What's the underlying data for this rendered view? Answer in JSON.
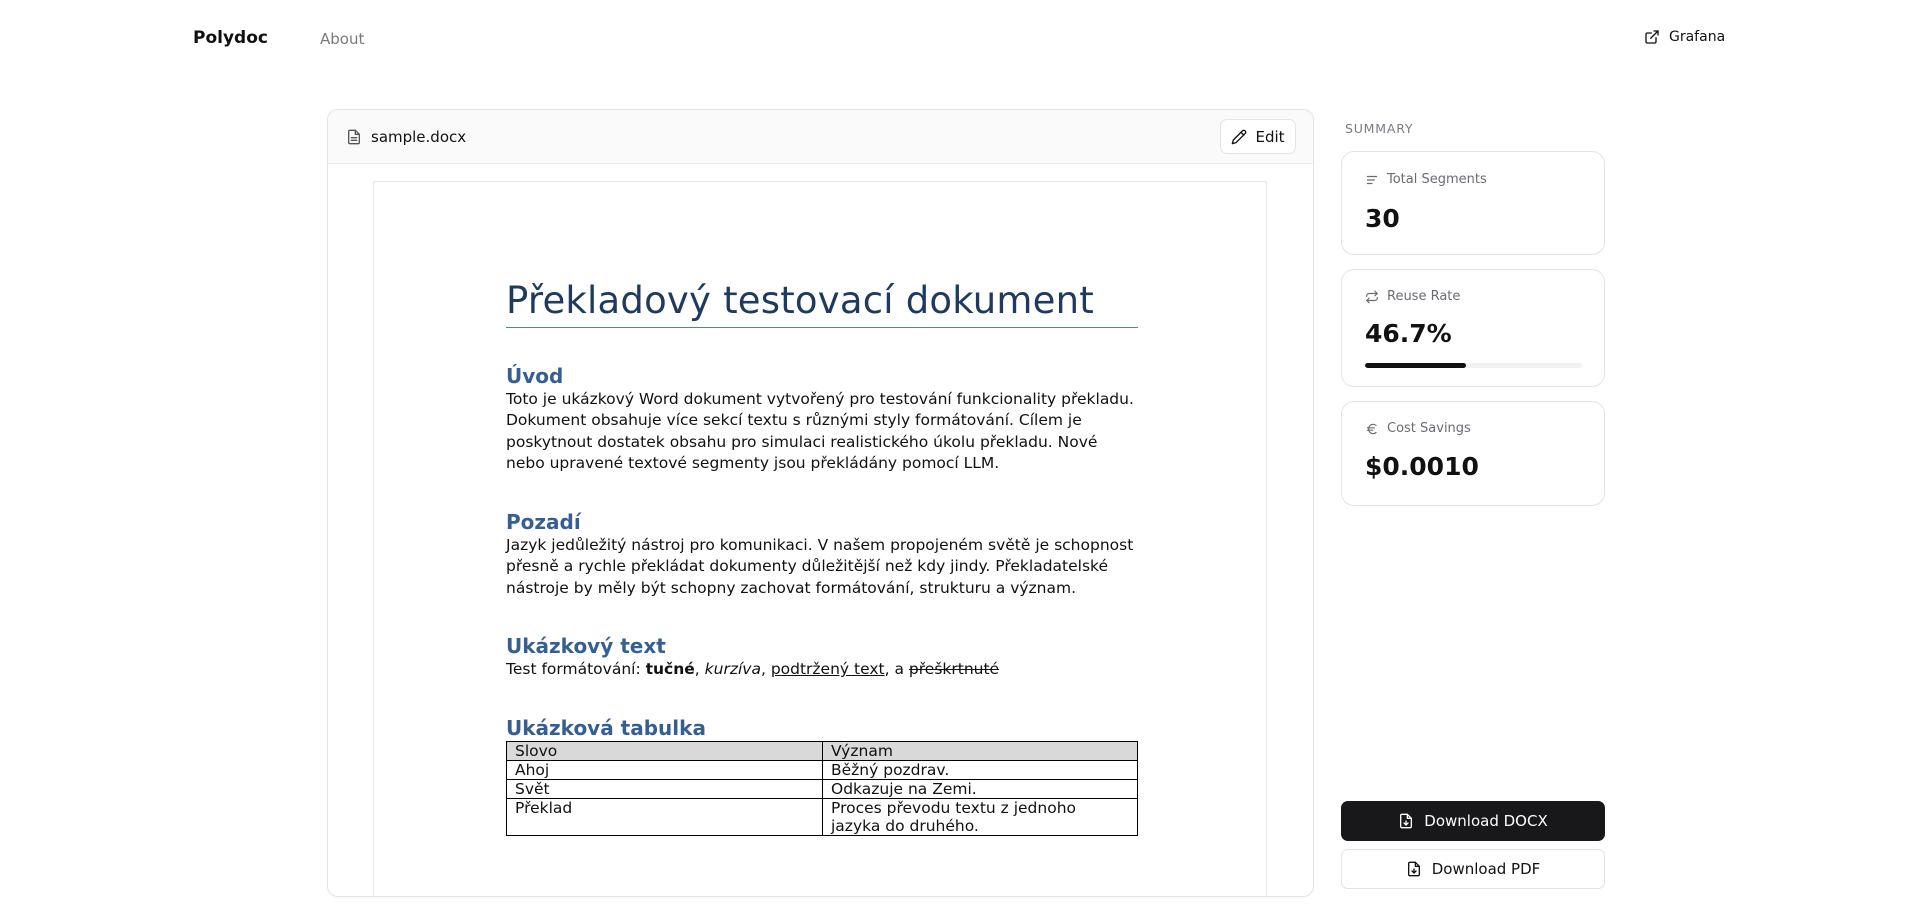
{
  "nav": {
    "brand": "Polydoc",
    "about": "About",
    "external_link": "Grafana",
    "external_icon": "external-link-icon"
  },
  "document": {
    "filename": "sample.docx",
    "file_icon": "file-text-icon",
    "edit_label": "Edit",
    "edit_icon": "pencil-icon",
    "title": "Překladový testovací dokument",
    "sections": {
      "intro_heading": "Úvod",
      "intro_text": "Toto je ukázkový Word dokument vytvořený pro testování funkcionality překladu. Dokument obsahuje více sekcí textu s různými styly formátování. Cílem je poskytnout dostatek obsahu pro simulaci realistického úkolu překladu. Nové nebo upravené textové segmenty jsou překládány pomocí LLM.",
      "background_heading": "Pozadí",
      "background_text": "Jazyk jedůležitý nástroj pro komunikaci. V našem propojeném světě je schopnost přesně a rychle překládat dokumenty důležitější než kdy jindy. Překladatelské nástroje by měly být schopny zachovat formátování, strukturu a význam.",
      "sample_heading": "Ukázkový text",
      "sample_prefix": "Test formátování: ",
      "sample_bold": "tučné",
      "sample_sep1": ", ",
      "sample_italic": "kurzíva",
      "sample_sep2": ", ",
      "sample_underline": "podtržený text",
      "sample_sep3": ", a ",
      "sample_strike": "přeškrtnuté",
      "table_heading": "Ukázková tabulka"
    },
    "table": {
      "headers": [
        "Slovo",
        "Význam"
      ],
      "rows": [
        [
          "Ahoj",
          "Běžný pozdrav."
        ],
        [
          "Svět",
          "Odkazuje na Zemi."
        ],
        [
          "Překlad",
          "Proces převodu textu z jednoho jazyka do druhého."
        ]
      ]
    }
  },
  "summary": {
    "label": "SUMMARY",
    "total_segments": {
      "title": "Total Segments",
      "value": "30",
      "icon": "list-icon"
    },
    "reuse_rate": {
      "title": "Reuse Rate",
      "value": "46.7%",
      "fraction": 0.467,
      "icon": "repeat-icon"
    },
    "cost_savings": {
      "title": "Cost Savings",
      "value": "$0.0010",
      "icon": "euro-icon"
    }
  },
  "actions": {
    "download_docx": "Download DOCX",
    "download_pdf": "Download PDF",
    "download_icon": "file-download-icon"
  }
}
